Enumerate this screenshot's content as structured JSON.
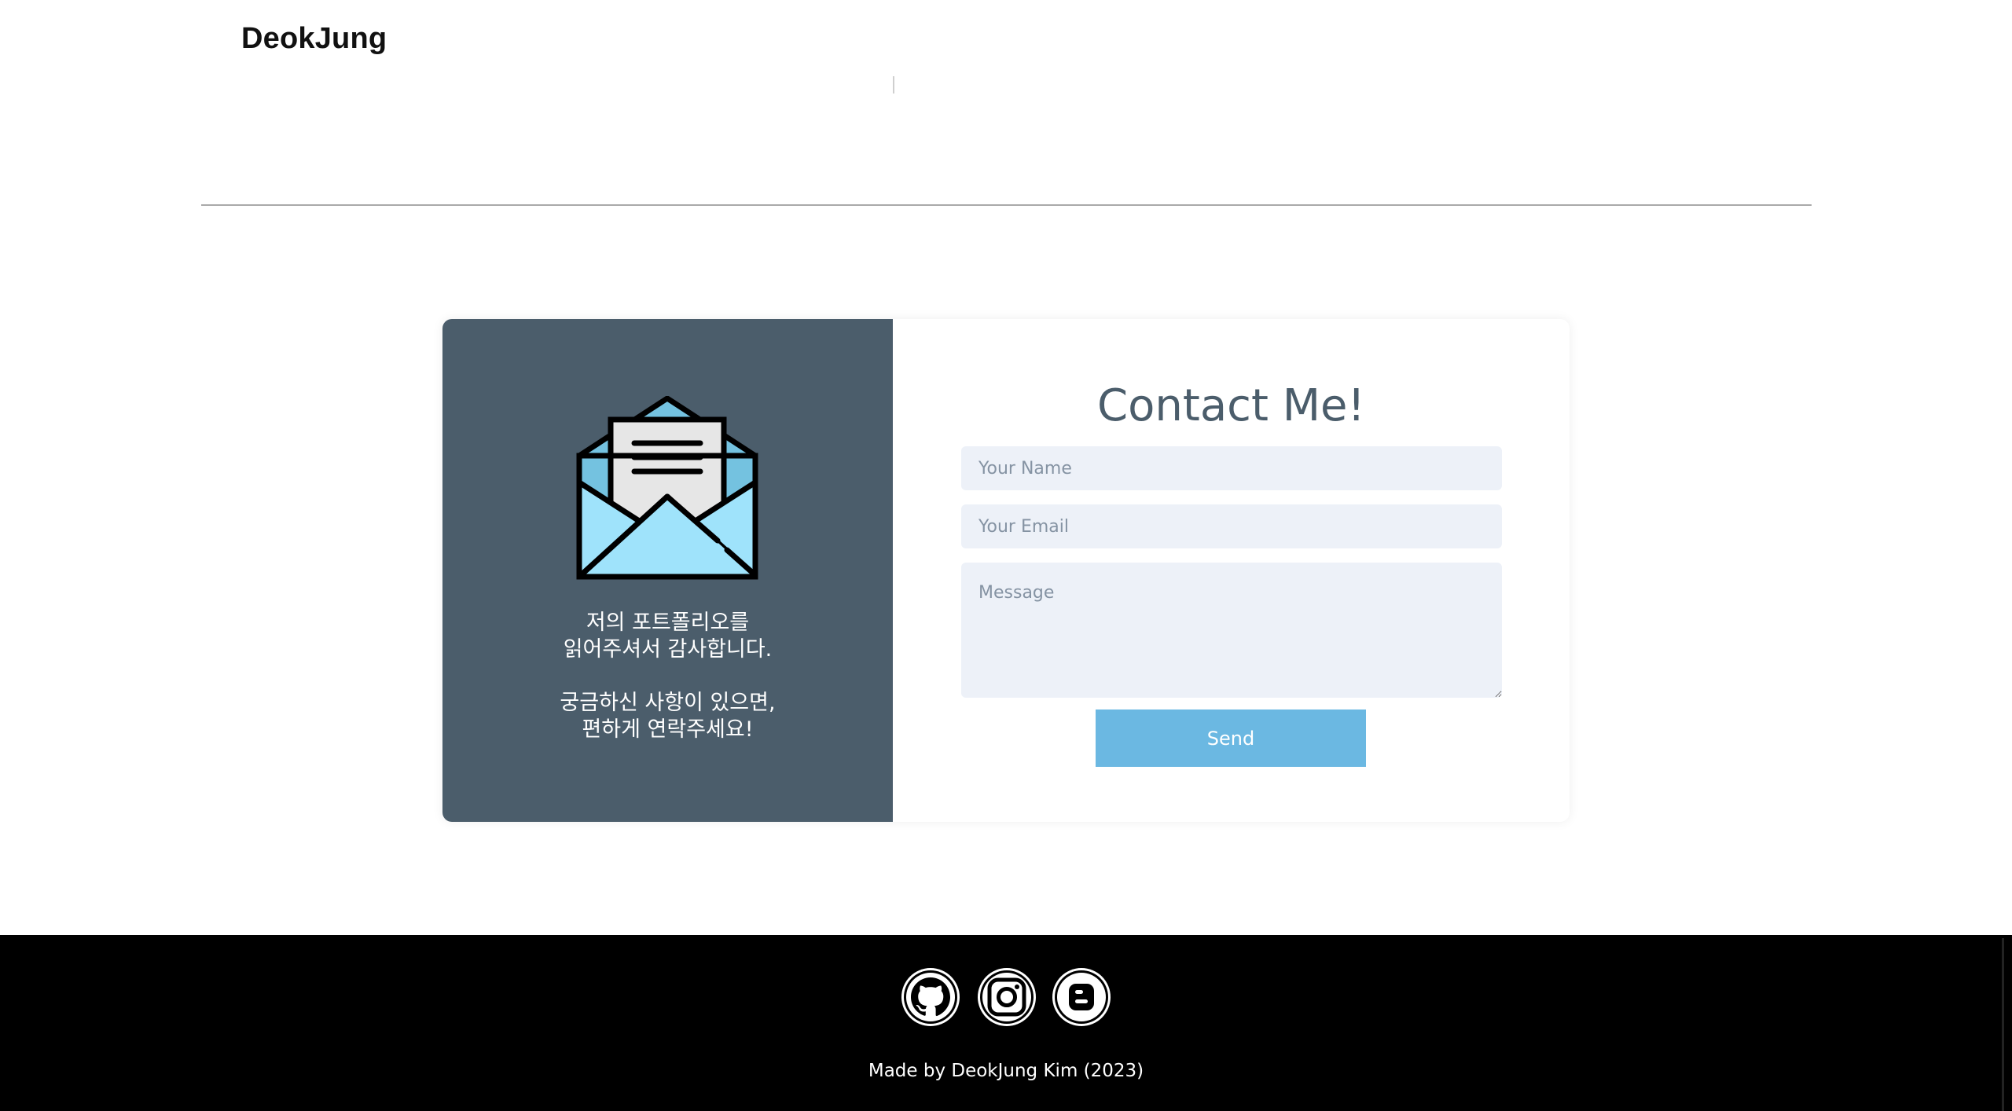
{
  "header": {
    "brand": "DeokJung"
  },
  "contact": {
    "left_panel": {
      "icon": "open-envelope-icon",
      "line1": "저의 포트폴리오를",
      "line2": "읽어주셔서 감사합니다.",
      "line3": "궁금하신 사항이 있으면,",
      "line4": "편하게 연락주세요!"
    },
    "title": "Contact Me!",
    "name_placeholder": "Your Name",
    "email_placeholder": "Your Email",
    "message_placeholder": "Message",
    "send_label": "Send",
    "colors": {
      "panel": "#4b5d6b",
      "field": "#edf1f8",
      "button": "#6bb8e2"
    }
  },
  "footer": {
    "social": [
      {
        "icon": "github-icon"
      },
      {
        "icon": "instagram-icon"
      },
      {
        "icon": "blogger-icon"
      }
    ],
    "copyright": "Made by DeokJung Kim (2023)"
  }
}
